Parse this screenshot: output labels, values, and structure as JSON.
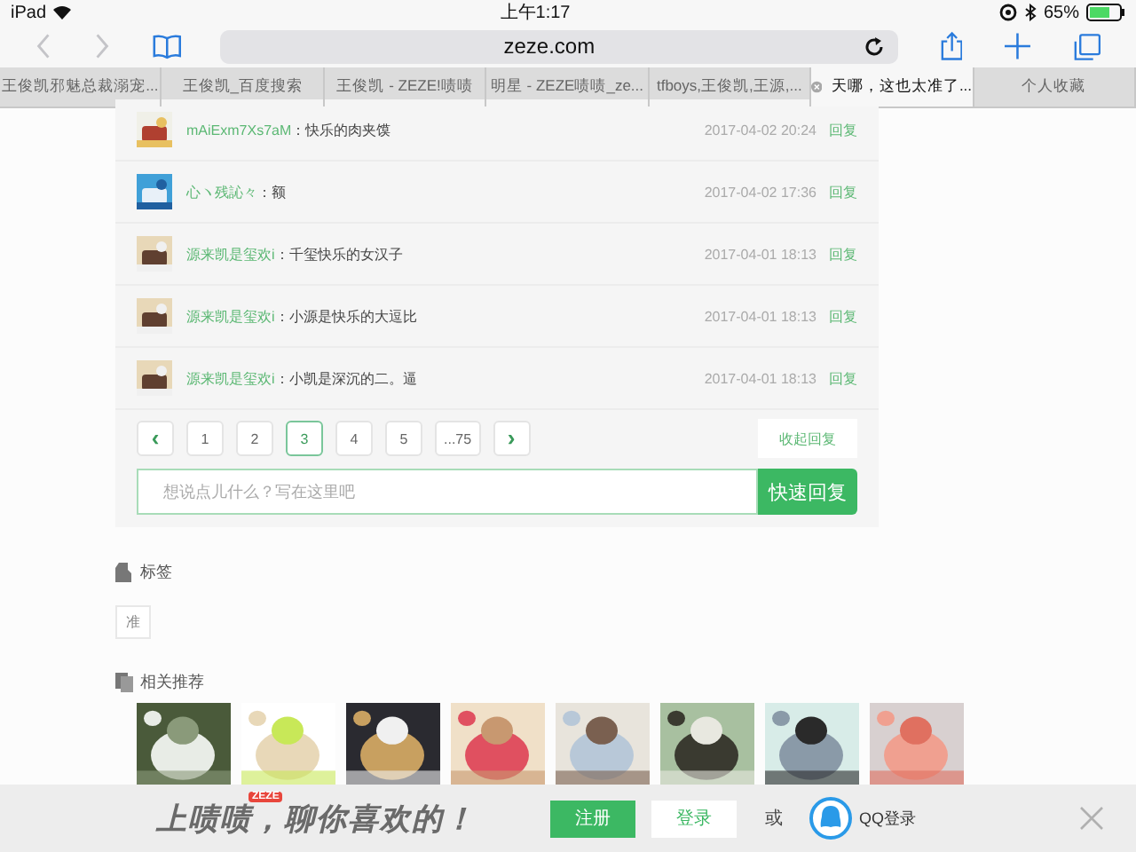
{
  "status_bar": {
    "device": "iPad",
    "time": "上午1:17",
    "battery": "65%"
  },
  "address_bar": {
    "url": "zeze.com"
  },
  "tabs": [
    {
      "label": "王俊凯邪魅总裁溺宠...",
      "selected": false
    },
    {
      "label": "王俊凯_百度搜索",
      "selected": false
    },
    {
      "label": "王俊凯 - ZEZE!啧啧",
      "selected": false
    },
    {
      "label": "明星 - ZEZE啧啧_ze...",
      "selected": false
    },
    {
      "label": "tfboys,王俊凯,王源,...",
      "selected": false
    },
    {
      "label": "天哪，这也太准了...",
      "selected": true
    },
    {
      "label": "个人收藏",
      "selected": false
    }
  ],
  "comments": [
    {
      "user": "mAiExm7Xs7aM",
      "separator": "：",
      "text": "快乐的肉夹馍",
      "time": "2017-04-02 20:24",
      "reply": "回复"
    },
    {
      "user": "心ヽ残訫々",
      "separator": "：",
      "text": "额",
      "time": "2017-04-02 17:36",
      "reply": "回复"
    },
    {
      "user": "源来凯是玺欢i",
      "separator": "：",
      "text": "千玺快乐的女汉子",
      "time": "2017-04-01 18:13",
      "reply": "回复"
    },
    {
      "user": "源来凯是玺欢i",
      "separator": "：",
      "text": "小源是快乐的大逗比",
      "time": "2017-04-01 18:13",
      "reply": "回复"
    },
    {
      "user": "源来凯是玺欢i",
      "separator": "：",
      "text": "小凯是深沉的二。逼",
      "time": "2017-04-01 18:13",
      "reply": "回复"
    }
  ],
  "pagination": [
    {
      "kind": "prev",
      "label": "‹",
      "selected": false
    },
    {
      "kind": "page",
      "label": "1",
      "selected": false
    },
    {
      "kind": "page",
      "label": "2",
      "selected": false
    },
    {
      "kind": "page",
      "label": "3",
      "selected": true
    },
    {
      "kind": "page",
      "label": "4",
      "selected": false
    },
    {
      "kind": "page",
      "label": "5",
      "selected": false
    },
    {
      "kind": "page",
      "label": "...75",
      "selected": false
    },
    {
      "kind": "next",
      "label": "›",
      "selected": false
    }
  ],
  "collapse_button": "收起回复",
  "reply_box": {
    "placeholder": "想说点儿什么？写在这里吧",
    "button": "快速回复"
  },
  "tags": {
    "title": "标签",
    "items": [
      "准"
    ]
  },
  "related": {
    "title": "相关推荐"
  },
  "login_bar": {
    "slogan": "上啧啧，聊你喜欢的！",
    "badge": "ZEZE",
    "register": "注册",
    "login": "登录",
    "or": "或",
    "qq_login": "QQ登录"
  }
}
